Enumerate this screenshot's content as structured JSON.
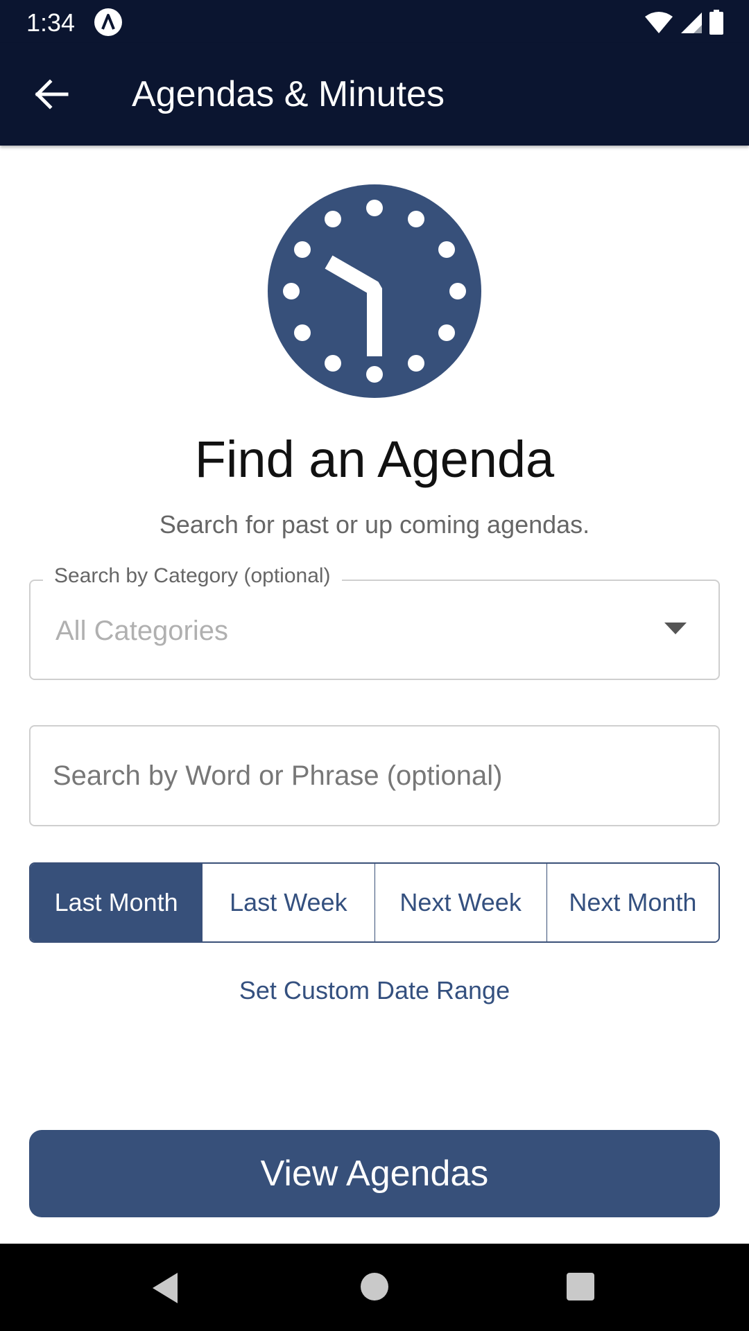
{
  "status_bar": {
    "time": "1:34",
    "icons": [
      "app-icon",
      "wifi-icon",
      "signal-icon",
      "battery-icon"
    ]
  },
  "app_bar": {
    "title": "Agendas & Minutes",
    "back_icon": "arrow-left-icon"
  },
  "hero": {
    "icon": "clock-icon",
    "heading": "Find an Agenda",
    "subheading": "Search for past or up coming agendas."
  },
  "category_select": {
    "label": "Search by Category (optional)",
    "value": "All Categories"
  },
  "word_search": {
    "placeholder": "Search by Word or Phrase (optional)",
    "value": ""
  },
  "date_segments": {
    "items": [
      {
        "label": "Last Month",
        "selected": true
      },
      {
        "label": "Last Week",
        "selected": false
      },
      {
        "label": "Next Week",
        "selected": false
      },
      {
        "label": "Next Month",
        "selected": false
      }
    ]
  },
  "custom_range_link": "Set Custom Date Range",
  "primary_action": "View Agendas",
  "colors": {
    "header_bg": "#0b1530",
    "accent": "#37507a",
    "link": "#34507f"
  },
  "nav_bar": {
    "icons": [
      "nav-back-icon",
      "nav-home-icon",
      "nav-recents-icon"
    ]
  }
}
